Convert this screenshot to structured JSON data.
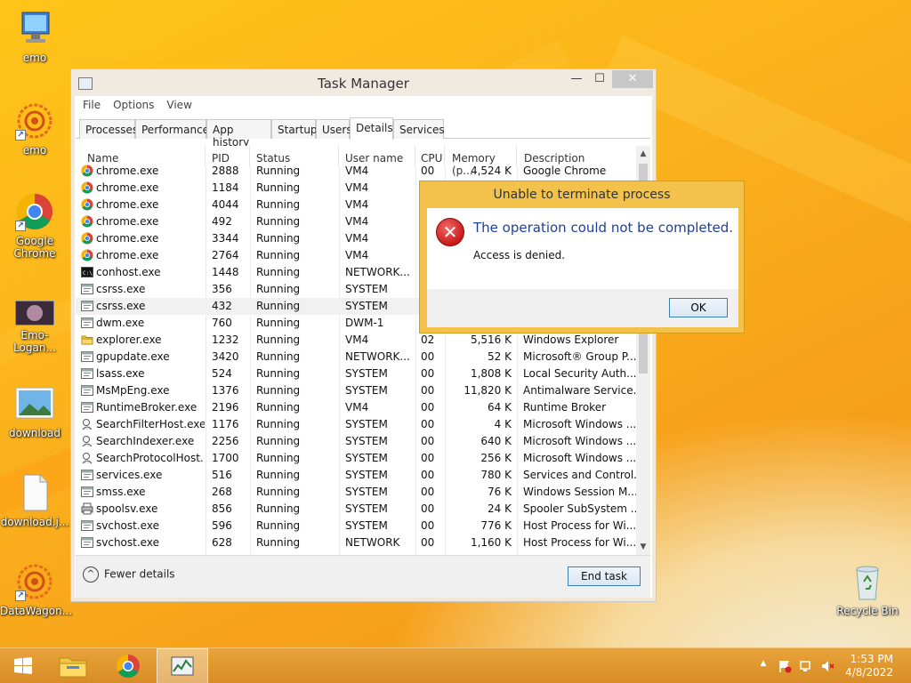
{
  "desktop": {
    "icons": [
      {
        "label": "emo",
        "kind": "computer"
      },
      {
        "label": "emo",
        "kind": "mandala"
      },
      {
        "label": "Google Chrome",
        "kind": "chrome"
      },
      {
        "label": "Emo-Logan...",
        "kind": "photo"
      },
      {
        "label": "download",
        "kind": "image"
      },
      {
        "label": "download.j...",
        "kind": "file"
      },
      {
        "label": "DataWagon...",
        "kind": "mandala"
      },
      {
        "label": "Recycle Bin",
        "kind": "recycle"
      }
    ]
  },
  "task_manager": {
    "title": "Task Manager",
    "window_buttons": {
      "minimize": "—",
      "maximize": "☐",
      "close": "✕"
    },
    "menu": [
      "File",
      "Options",
      "View"
    ],
    "tabs": [
      "Processes",
      "Performance",
      "App history",
      "Startup",
      "Users",
      "Details",
      "Services"
    ],
    "active_tab": "Details",
    "columns": [
      "Name",
      "PID",
      "Status",
      "User name",
      "CPU",
      "Memory (p...",
      "Description"
    ],
    "sort_indicator": "^",
    "rows": [
      {
        "name": "chrome.exe",
        "pid": "2888",
        "status": "Running",
        "user": "VM4",
        "cpu": "00",
        "mem": "4,524 K",
        "desc": "Google Chrome",
        "icon": "chrome"
      },
      {
        "name": "chrome.exe",
        "pid": "1184",
        "status": "Running",
        "user": "VM4",
        "cpu": "",
        "mem": "",
        "desc": "",
        "icon": "chrome"
      },
      {
        "name": "chrome.exe",
        "pid": "4044",
        "status": "Running",
        "user": "VM4",
        "cpu": "",
        "mem": "",
        "desc": "",
        "icon": "chrome"
      },
      {
        "name": "chrome.exe",
        "pid": "492",
        "status": "Running",
        "user": "VM4",
        "cpu": "",
        "mem": "",
        "desc": "",
        "icon": "chrome"
      },
      {
        "name": "chrome.exe",
        "pid": "3344",
        "status": "Running",
        "user": "VM4",
        "cpu": "",
        "mem": "",
        "desc": "",
        "icon": "chrome"
      },
      {
        "name": "chrome.exe",
        "pid": "2764",
        "status": "Running",
        "user": "VM4",
        "cpu": "",
        "mem": "",
        "desc": "",
        "icon": "chrome"
      },
      {
        "name": "conhost.exe",
        "pid": "1448",
        "status": "Running",
        "user": "NETWORK...",
        "cpu": "",
        "mem": "",
        "desc": "",
        "icon": "console"
      },
      {
        "name": "csrss.exe",
        "pid": "356",
        "status": "Running",
        "user": "SYSTEM",
        "cpu": "",
        "mem": "",
        "desc": "",
        "icon": "window"
      },
      {
        "name": "csrss.exe",
        "pid": "432",
        "status": "Running",
        "user": "SYSTEM",
        "cpu": "",
        "mem": "",
        "desc": "",
        "icon": "window",
        "selected": true
      },
      {
        "name": "dwm.exe",
        "pid": "760",
        "status": "Running",
        "user": "DWM-1",
        "cpu": "",
        "mem": "",
        "desc": "",
        "icon": "window"
      },
      {
        "name": "explorer.exe",
        "pid": "1232",
        "status": "Running",
        "user": "VM4",
        "cpu": "02",
        "mem": "5,516 K",
        "desc": "Windows Explorer",
        "icon": "folder"
      },
      {
        "name": "gpupdate.exe",
        "pid": "3420",
        "status": "Running",
        "user": "NETWORK...",
        "cpu": "00",
        "mem": "52 K",
        "desc": "Microsoft® Group P...",
        "icon": "window"
      },
      {
        "name": "lsass.exe",
        "pid": "524",
        "status": "Running",
        "user": "SYSTEM",
        "cpu": "00",
        "mem": "1,808 K",
        "desc": "Local Security Auth...",
        "icon": "window"
      },
      {
        "name": "MsMpEng.exe",
        "pid": "1376",
        "status": "Running",
        "user": "SYSTEM",
        "cpu": "00",
        "mem": "11,820 K",
        "desc": "Antimalware Service...",
        "icon": "window"
      },
      {
        "name": "RuntimeBroker.exe",
        "pid": "2196",
        "status": "Running",
        "user": "VM4",
        "cpu": "00",
        "mem": "64 K",
        "desc": "Runtime Broker",
        "icon": "window"
      },
      {
        "name": "SearchFilterHost.exe",
        "pid": "1176",
        "status": "Running",
        "user": "SYSTEM",
        "cpu": "00",
        "mem": "4 K",
        "desc": "Microsoft Windows ...",
        "icon": "search"
      },
      {
        "name": "SearchIndexer.exe",
        "pid": "2256",
        "status": "Running",
        "user": "SYSTEM",
        "cpu": "00",
        "mem": "640 K",
        "desc": "Microsoft Windows ...",
        "icon": "search"
      },
      {
        "name": "SearchProtocolHost....",
        "pid": "1700",
        "status": "Running",
        "user": "SYSTEM",
        "cpu": "00",
        "mem": "256 K",
        "desc": "Microsoft Windows ...",
        "icon": "search"
      },
      {
        "name": "services.exe",
        "pid": "516",
        "status": "Running",
        "user": "SYSTEM",
        "cpu": "00",
        "mem": "780 K",
        "desc": "Services and Control...",
        "icon": "window"
      },
      {
        "name": "smss.exe",
        "pid": "268",
        "status": "Running",
        "user": "SYSTEM",
        "cpu": "00",
        "mem": "76 K",
        "desc": "Windows Session M...",
        "icon": "window"
      },
      {
        "name": "spoolsv.exe",
        "pid": "856",
        "status": "Running",
        "user": "SYSTEM",
        "cpu": "00",
        "mem": "24 K",
        "desc": "Spooler SubSystem ...",
        "icon": "printer"
      },
      {
        "name": "svchost.exe",
        "pid": "596",
        "status": "Running",
        "user": "SYSTEM",
        "cpu": "00",
        "mem": "776 K",
        "desc": "Host Process for Wi...",
        "icon": "window"
      },
      {
        "name": "svchost.exe",
        "pid": "628",
        "status": "Running",
        "user": "NETWORK",
        "cpu": "00",
        "mem": "1,160 K",
        "desc": "Host Process for Wi...",
        "icon": "window"
      }
    ],
    "footer": {
      "fewer_details": "Fewer details",
      "fewer_icon": "^",
      "end_task": "End task"
    }
  },
  "dialog": {
    "title": "Unable to terminate process",
    "main": "The operation could not be completed.",
    "sub": "Access is denied.",
    "icon_glyph": "✕",
    "ok": "OK"
  },
  "taskbar": {
    "items": [
      "start",
      "file-explorer",
      "chrome",
      "task-manager"
    ],
    "active": "task-manager",
    "time": "1:53 PM",
    "date": "4/8/2022",
    "tray_chevron": "▲"
  }
}
